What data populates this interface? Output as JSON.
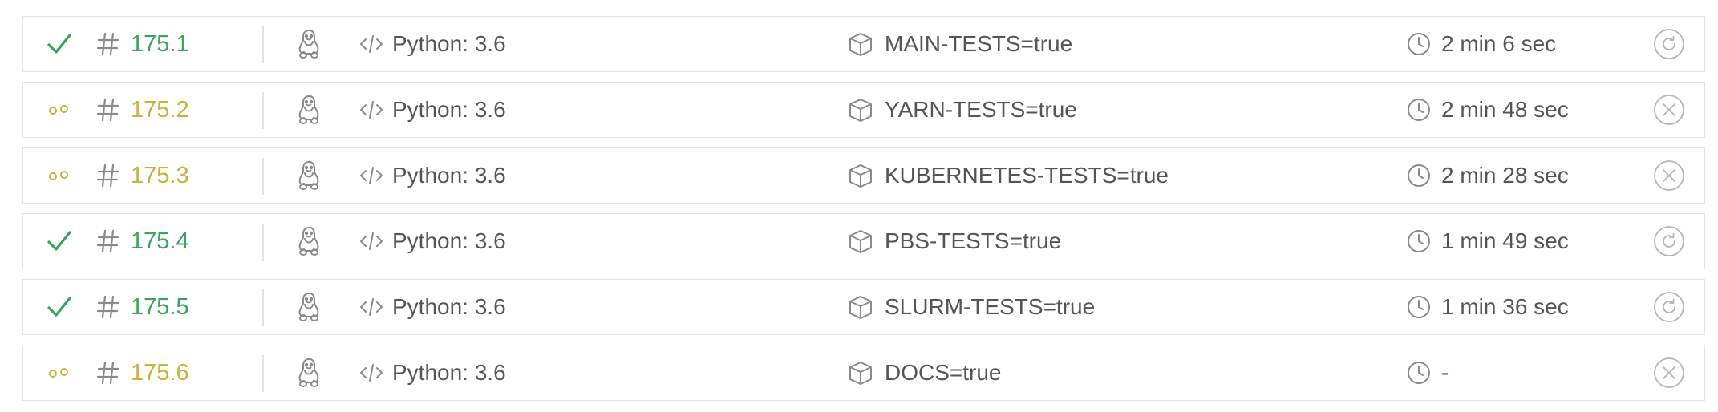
{
  "colors": {
    "passed": "#3aa35b",
    "started": "#c9b23a",
    "icon_gray": "#8a8a8a",
    "border": "#e4e4e4"
  },
  "jobs": [
    {
      "status": "passed",
      "number": "175.1",
      "os_icon": "linux-icon",
      "language": "Python: 3.6",
      "env": "MAIN-TESTS=true",
      "duration": "2 min 6 sec",
      "action": "restart"
    },
    {
      "status": "started",
      "number": "175.2",
      "os_icon": "linux-icon",
      "language": "Python: 3.6",
      "env": "YARN-TESTS=true",
      "duration": "2 min 48 sec",
      "action": "cancel"
    },
    {
      "status": "started",
      "number": "175.3",
      "os_icon": "linux-icon",
      "language": "Python: 3.6",
      "env": "KUBERNETES-TESTS=true",
      "duration": "2 min 28 sec",
      "action": "cancel"
    },
    {
      "status": "passed",
      "number": "175.4",
      "os_icon": "linux-icon",
      "language": "Python: 3.6",
      "env": "PBS-TESTS=true",
      "duration": "1 min 49 sec",
      "action": "restart"
    },
    {
      "status": "passed",
      "number": "175.5",
      "os_icon": "linux-icon",
      "language": "Python: 3.6",
      "env": "SLURM-TESTS=true",
      "duration": "1 min 36 sec",
      "action": "restart"
    },
    {
      "status": "started",
      "number": "175.6",
      "os_icon": "linux-icon",
      "language": "Python: 3.6",
      "env": "DOCS=true",
      "duration": "-",
      "action": "cancel"
    }
  ]
}
